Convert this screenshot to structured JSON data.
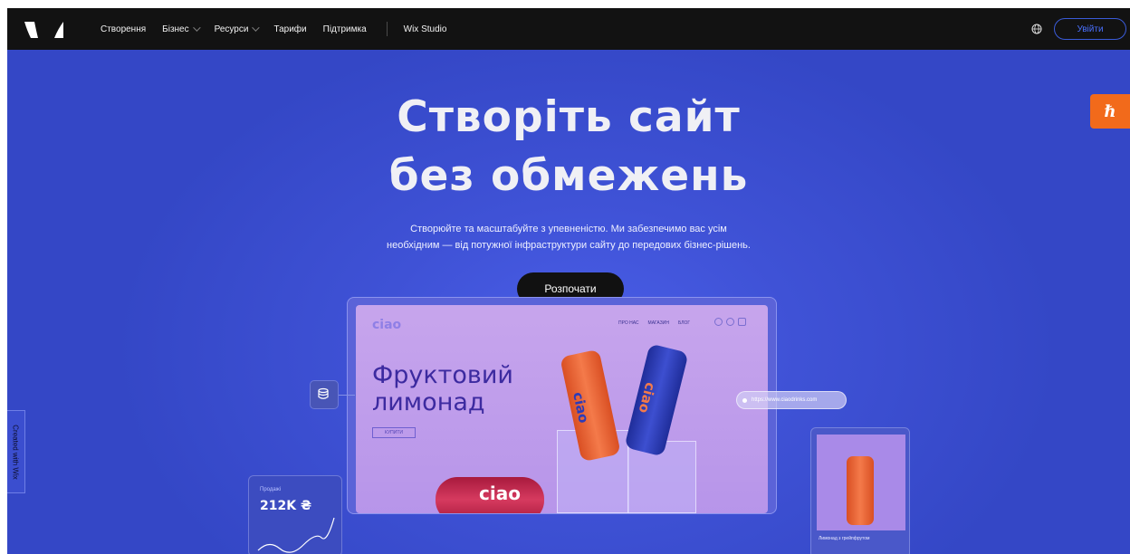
{
  "nav": {
    "items": [
      {
        "label": "Створення",
        "has_dropdown": false
      },
      {
        "label": "Бізнес",
        "has_dropdown": true
      },
      {
        "label": "Ресурси",
        "has_dropdown": true
      },
      {
        "label": "Тарифи",
        "has_dropdown": false
      },
      {
        "label": "Підтримка",
        "has_dropdown": false
      }
    ],
    "studio_label": "Wix Studio",
    "login_label": "Увійти"
  },
  "hero": {
    "title_line1": "Створіть сайт",
    "title_line2": "без обмежень",
    "subtitle_line1": "Створюйте та масштабуйте з упевненістю. Ми забезпечимо вас усім",
    "subtitle_line2": "необхідним — від потужної інфраструктури сайту до передових бізнес-рішень.",
    "cta_label": "Розпочати"
  },
  "side": {
    "hire_badge": "ℏ",
    "created_with": "Created with Wix"
  },
  "mockup": {
    "brand": "ciao",
    "nav": [
      "ПРО НАС",
      "МАГАЗИН",
      "БЛОГ"
    ],
    "title_line1": "Фруктовий",
    "title_line2": "лимонад",
    "buy_label": "КУПИТИ",
    "can_text": "ciao",
    "url": "https://www.ciaodrinks.com",
    "sales_label": "Продажі",
    "sales_value": "212K ₴",
    "product_caption": "Лимонад з грейпфрутом"
  },
  "colors": {
    "topbar": "#121212",
    "hero_bg": "#3f52d6",
    "accent": "#4a70ff",
    "hire_orange": "#f26a1b",
    "can_orange": "#f0673a",
    "can_blue": "#2c3bb8",
    "can_red": "#c2224a"
  }
}
